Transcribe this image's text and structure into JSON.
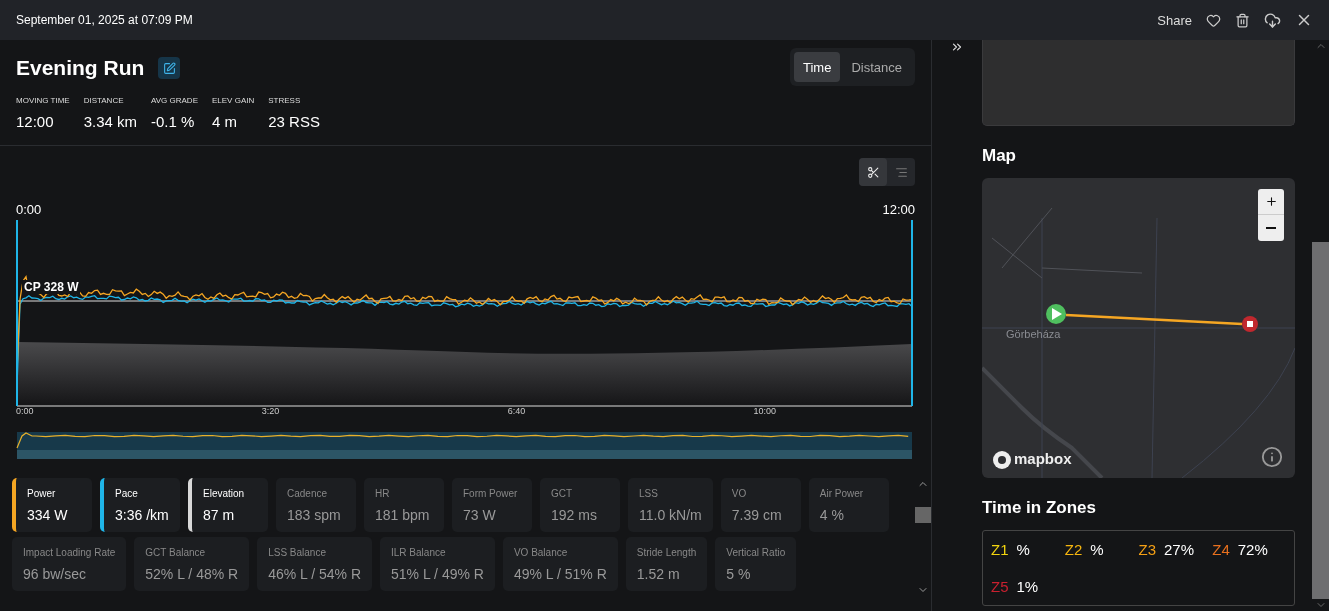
{
  "header": {
    "date": "September 01, 2025 at 07:09 PM",
    "share_label": "Share"
  },
  "activity": {
    "title": "Evening Run",
    "view_tabs": [
      {
        "label": "Time",
        "selected": true
      },
      {
        "label": "Distance",
        "selected": false
      }
    ],
    "stats": [
      {
        "label": "MOVING TIME",
        "value": "12:00"
      },
      {
        "label": "DISTANCE",
        "value": "3.34 km"
      },
      {
        "label": "AVG GRADE",
        "value": "-0.1 %"
      },
      {
        "label": "ELEV GAIN",
        "value": "4 m"
      },
      {
        "label": "STRESS",
        "value": "23 RSS"
      }
    ]
  },
  "chart": {
    "range_start": "0:00",
    "range_end": "12:00",
    "cp_label": "CP 328 W",
    "axis_labels": [
      "0:00",
      "3:20",
      "6:40",
      "10:00"
    ]
  },
  "metrics": [
    {
      "label": "Power",
      "value": "334 W",
      "selected": true,
      "color": "#f5a623"
    },
    {
      "label": "Pace",
      "value": "3:36 /km",
      "selected": true,
      "color": "#1fb5e8"
    },
    {
      "label": "Elevation",
      "value": "87 m",
      "selected": true,
      "color": "#d8d8d8"
    },
    {
      "label": "Cadence",
      "value": "183 spm",
      "selected": false
    },
    {
      "label": "HR",
      "value": "181 bpm",
      "selected": false
    },
    {
      "label": "Form Power",
      "value": "73 W",
      "selected": false
    },
    {
      "label": "GCT",
      "value": "192 ms",
      "selected": false
    },
    {
      "label": "LSS",
      "value": "11.0 kN/m",
      "selected": false
    },
    {
      "label": "VO",
      "value": "7.39 cm",
      "selected": false
    },
    {
      "label": "Air Power",
      "value": "4 %",
      "selected": false
    },
    {
      "label": "Impact Loading Rate",
      "value": "96 bw/sec",
      "selected": false
    },
    {
      "label": "GCT Balance",
      "value": "52% L / 48% R",
      "selected": false
    },
    {
      "label": "LSS Balance",
      "value": "46% L / 54% R",
      "selected": false
    },
    {
      "label": "ILR Balance",
      "value": "51% L / 49% R",
      "selected": false
    },
    {
      "label": "VO Balance",
      "value": "49% L / 51% R",
      "selected": false
    },
    {
      "label": "Stride Length",
      "value": "1.52 m",
      "selected": false
    },
    {
      "label": "Vertical Ratio",
      "value": "5 %",
      "selected": false
    }
  ],
  "map": {
    "title": "Map",
    "place_label": "Görbeháza",
    "attribution": "mapbox"
  },
  "zones": {
    "title": "Time in Zones",
    "items": [
      {
        "name": "Z1",
        "value": "%",
        "color": "#f2d40f"
      },
      {
        "name": "Z2",
        "value": "%",
        "color": "#f5b50f"
      },
      {
        "name": "Z3",
        "value": "27%",
        "color": "#f5a015"
      },
      {
        "name": "Z4",
        "value": "72%",
        "color": "#e8701e"
      },
      {
        "name": "Z5",
        "value": "1%",
        "color": "#c8202f"
      }
    ]
  }
}
